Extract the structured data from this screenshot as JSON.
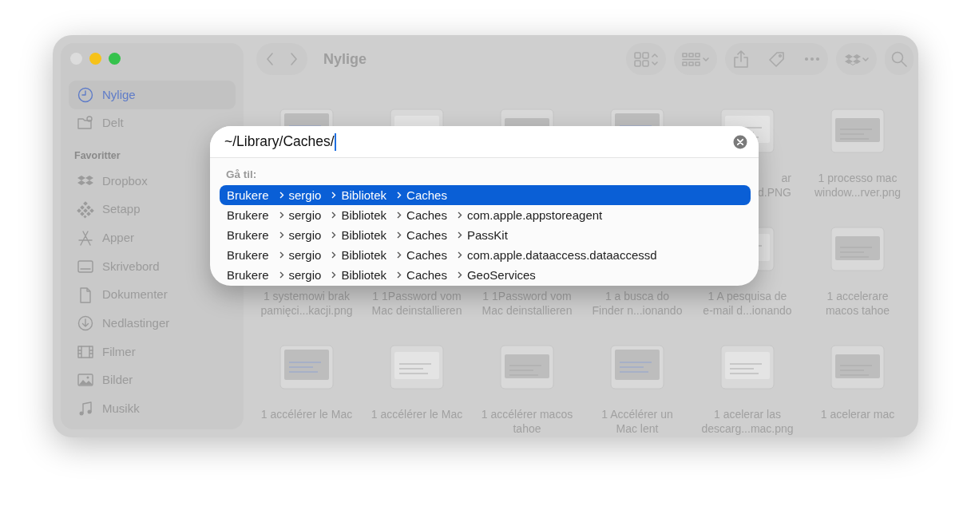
{
  "window": {
    "title": "Nylige"
  },
  "sidebar": {
    "top_items": [
      {
        "label": "Nylige",
        "selected": true
      },
      {
        "label": "Delt",
        "selected": false
      }
    ],
    "section_title": "Favoritter",
    "items": [
      {
        "label": "Dropbox",
        "selected": false
      },
      {
        "label": "Setapp",
        "selected": false
      },
      {
        "label": "Apper",
        "selected": false
      },
      {
        "label": "Skrivebord",
        "selected": false
      },
      {
        "label": "Dokumenter",
        "selected": false
      },
      {
        "label": "Nedlastinger",
        "selected": false
      },
      {
        "label": "Filmer",
        "selected": false
      },
      {
        "label": "Bilder",
        "selected": false
      },
      {
        "label": "Musikk",
        "selected": false
      }
    ]
  },
  "files": [
    [
      {
        "thumbnail": true
      },
      {
        "thumbnail": true
      },
      {
        "thumbnail": true
      },
      {
        "thumbnail": true
      },
      {
        "thumbnail": true,
        "caption": [
          "ar",
          "d.PNG"
        ],
        "cut": true
      },
      {
        "thumbnail": true,
        "caption": [
          "1  processo mac",
          "window...rver.png"
        ]
      }
    ],
    [
      {
        "thumbnail": false,
        "caption": [
          "1 systemowi brak",
          "pamięci...kacji.png"
        ]
      },
      {
        "thumbnail": false,
        "caption": [
          "1 1Password vom",
          "Mac deinstallieren"
        ]
      },
      {
        "thumbnail": false,
        "caption": [
          "1 1Password vom",
          "Mac deinstallieren"
        ]
      },
      {
        "thumbnail": false,
        "caption": [
          "1 a busca do",
          "Finder n...ionando"
        ]
      },
      {
        "thumbnail": true,
        "caption": [
          "1 A pesquisa de",
          "e-mail d...ionando"
        ]
      },
      {
        "thumbnail": true,
        "caption": [
          "1 accelerare",
          "macos tahoe"
        ]
      }
    ],
    [
      {
        "thumbnail": true,
        "caption": [
          "1 accélérer le Mac"
        ]
      },
      {
        "thumbnail": true,
        "caption": [
          "1 accélérer le Mac"
        ]
      },
      {
        "thumbnail": true,
        "caption": [
          "1 accélérer macos",
          "tahoe"
        ]
      },
      {
        "thumbnail": true,
        "caption": [
          "1 Accélérer un",
          "Mac lent"
        ]
      },
      {
        "thumbnail": true,
        "caption": [
          "1 acelerar las",
          "descarg...mac.png"
        ]
      },
      {
        "thumbnail": true,
        "caption": [
          "1 acelerar mac"
        ]
      }
    ]
  ],
  "go_to_dialog": {
    "path": "~/Library/Caches/",
    "heading": "Gå til:",
    "suggestions": [
      {
        "segments": [
          "Brukere",
          "sergio",
          "Bibliotek",
          "Caches"
        ],
        "selected": true
      },
      {
        "segments": [
          "Brukere",
          "sergio",
          "Bibliotek",
          "Caches",
          "com.apple.appstoreagent"
        ],
        "selected": false
      },
      {
        "segments": [
          "Brukere",
          "sergio",
          "Bibliotek",
          "Caches",
          "PassKit"
        ],
        "selected": false
      },
      {
        "segments": [
          "Brukere",
          "sergio",
          "Bibliotek",
          "Caches",
          "com.apple.dataaccess.dataaccessd"
        ],
        "selected": false
      },
      {
        "segments": [
          "Brukere",
          "sergio",
          "Bibliotek",
          "Caches",
          "GeoServices"
        ],
        "selected": false
      }
    ]
  }
}
